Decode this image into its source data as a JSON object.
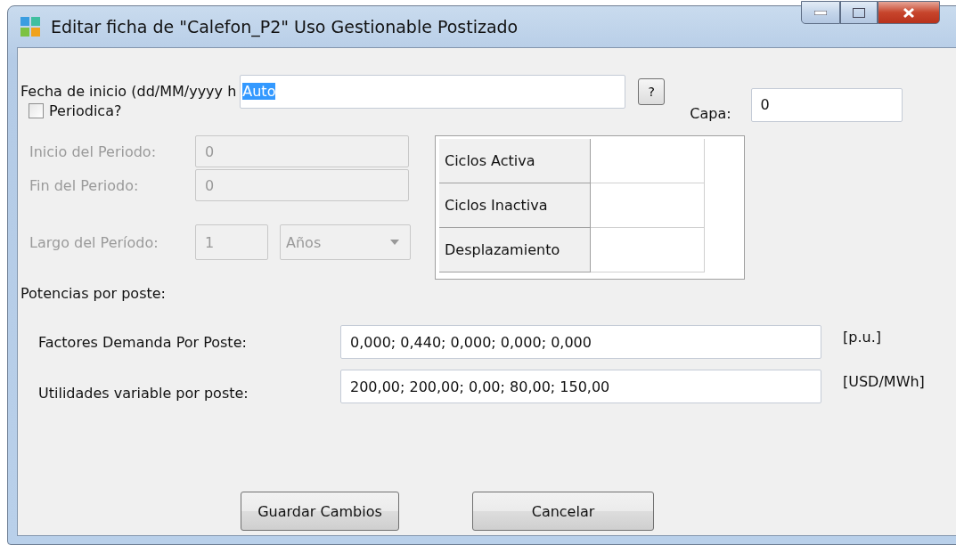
{
  "window": {
    "title": "Editar ficha de  \"Calefon_P2\" Uso Gestionable Postizado"
  },
  "start_date": {
    "label": "Fecha de inicio (dd/MM/yyyy h",
    "value": "Auto",
    "value_selected": true
  },
  "help_button": "?",
  "layer": {
    "label": "Capa:",
    "value": "0"
  },
  "periodic": {
    "label": "Periodica?",
    "checked": false
  },
  "period": {
    "disabled": true,
    "start": {
      "label": "Inicio del Periodo:",
      "value": "0"
    },
    "end": {
      "label": "Fin del Periodo:",
      "value": "0"
    },
    "length": {
      "label": "Largo del Período:",
      "value": "1",
      "unit": "Años"
    }
  },
  "cycles_table": {
    "rows": [
      {
        "label": "Ciclos Activa"
      },
      {
        "label": "Ciclos Inactiva"
      },
      {
        "label": "Desplazamiento"
      }
    ]
  },
  "section_title": "Potencias por poste:",
  "params": [
    {
      "label": "Factores Demanda Por Poste:",
      "value": "0,000; 0,440; 0,000; 0,000; 0,000",
      "unit": "[p.u.]"
    },
    {
      "label": "Utilidades variable por poste:",
      "value": "200,00; 200,00; 0,00; 80,00; 150,00",
      "unit": "[USD/MWh]"
    }
  ],
  "buttons": [
    "Guardar Cambios",
    "Cancelar"
  ]
}
